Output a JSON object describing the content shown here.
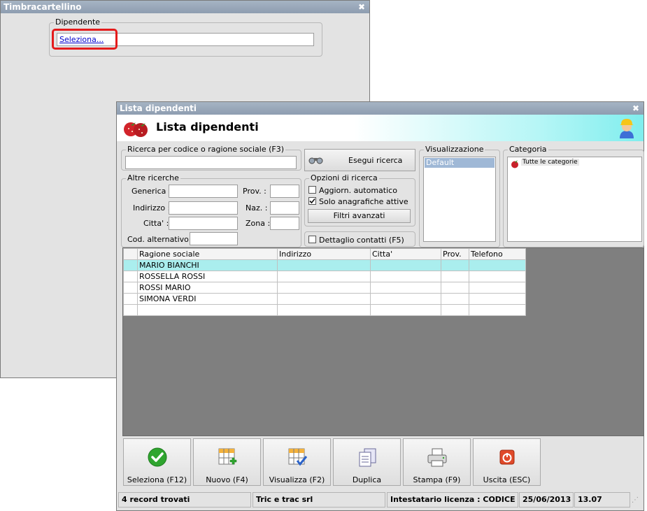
{
  "back_window": {
    "title": "Timbracartellino",
    "dipendente_label": "Dipendente",
    "seleziona_link": "Seleziona..."
  },
  "main_window": {
    "title": "Lista dipendenti",
    "header_title": "Lista dipendenti",
    "search": {
      "group_label": "Ricerca per codice o ragione sociale (F3)",
      "value": "",
      "button_label": "Esegui ricerca"
    },
    "other_searches": {
      "group_label": "Altre ricerche",
      "generica_label": "Generica :",
      "indirizzo_label": "Indirizzo :",
      "citta_label": "Citta' :",
      "cod_alt_label": "Cod. alternativo :",
      "prov_label": "Prov. :",
      "naz_label": "Naz. :",
      "zona_label": "Zona :"
    },
    "search_options": {
      "group_label": "Opzioni di ricerca",
      "auto_update_label": "Aggiorn. automatico",
      "auto_update_checked": false,
      "only_active_label": "Solo anagrafiche attive",
      "only_active_checked": true,
      "advanced_filters_label": "Filtri avanzati"
    },
    "contact_detail": {
      "label": "Dettaglio contatti (F5)",
      "checked": false
    },
    "visualizzazione": {
      "group_label": "Visualizzazione",
      "items": [
        "Default"
      ]
    },
    "categoria": {
      "group_label": "Categoria",
      "items": [
        "Tutte le categorie"
      ]
    },
    "table": {
      "columns": [
        "Ragione sociale",
        "Indirizzo",
        "Citta'",
        "Prov.",
        "Telefono"
      ],
      "rows": [
        [
          "MARIO BIANCHI",
          "",
          "",
          "",
          ""
        ],
        [
          "ROSSELLA ROSSI",
          "",
          "",
          "",
          ""
        ],
        [
          "ROSSI MARIO",
          "",
          "",
          "",
          ""
        ],
        [
          "SIMONA VERDI",
          "",
          "",
          "",
          ""
        ]
      ],
      "selected_row": 0
    },
    "toolbar": {
      "seleziona": "Seleziona (F12)",
      "nuovo": "Nuovo (F4)",
      "visualizza": "Visualizza (F2)",
      "duplica": "Duplica",
      "stampa": "Stampa (F9)",
      "uscita": "Uscita (ESC)"
    },
    "status": {
      "records": "4 record trovati",
      "company": "Tric e trac srl",
      "license": "Intestatario licenza : CODICE SRL",
      "date": "25/06/2013",
      "time": "13.07"
    }
  },
  "colors": {
    "titlebar": "#95a4b7",
    "selected_row": "#aaeeee",
    "highlight_box": "#e41b1b",
    "grid_background": "#7f7f7f"
  }
}
